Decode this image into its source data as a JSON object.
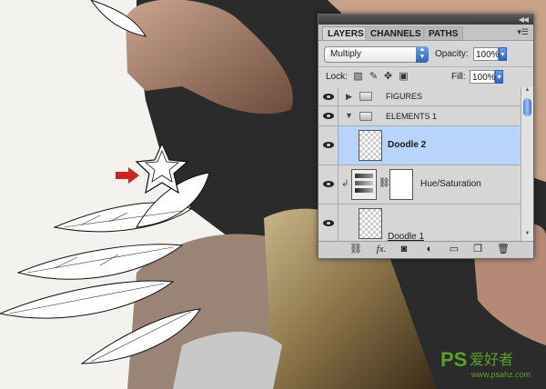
{
  "panel": {
    "tabs": [
      {
        "label": "LAYERS"
      },
      {
        "label": "CHANNELS"
      },
      {
        "label": "PATHS"
      }
    ],
    "blend_mode": "Multiply",
    "opacity_label": "Opacity:",
    "opacity_value": "100%",
    "lock_label": "Lock:",
    "fill_label": "Fill:",
    "fill_value": "100%",
    "layers": [
      {
        "name": "FIGURES",
        "type": "group",
        "expanded": false
      },
      {
        "name": "ELEMENTS 1",
        "type": "group",
        "expanded": true
      },
      {
        "name": "Doodle 2",
        "type": "layer",
        "selected": true
      },
      {
        "name": "Hue/Saturation",
        "type": "adjustment"
      },
      {
        "name": "Doodle 1",
        "type": "layer"
      }
    ],
    "bottom_icons": [
      "link-layers-icon",
      "fx-icon",
      "add-mask-icon",
      "adjustment-layer-icon",
      "new-group-icon",
      "new-layer-icon",
      "trash-icon"
    ],
    "fx_label": "fx."
  },
  "watermark": {
    "text": "PS爱好者",
    "url": "www.psahz.com"
  },
  "colors": {
    "selected_row": "#b8d4fb",
    "accent_blue": "#2e63c4",
    "red_arrow": "#cc2222",
    "watermark_green": "#5aa02c"
  }
}
